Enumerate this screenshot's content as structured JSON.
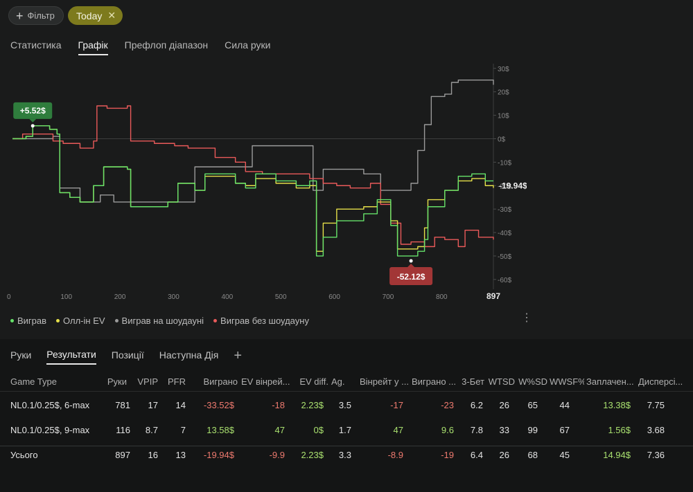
{
  "filter": {
    "add_label": "Фільтр",
    "chip_label": "Today"
  },
  "tabs": [
    "Статистика",
    "Графік",
    "Префлоп діапазон",
    "Сила руки"
  ],
  "chart_data": {
    "type": "line",
    "x_ticks": [
      "0",
      "100",
      "200",
      "300",
      "400",
      "500",
      "600",
      "700",
      "800",
      "897"
    ],
    "y_ticks": [
      "30$",
      "20$",
      "10$",
      "0$",
      "-10$",
      "-20$",
      "-30$",
      "-40$",
      "-50$",
      "-60$"
    ],
    "xlim": [
      0,
      897
    ],
    "ylim": [
      -63,
      32
    ],
    "colors": {
      "won": "#66e36a",
      "allin": "#e6e04a",
      "showdown": "#9b9b9b",
      "nonsd": "#ea5a5a"
    },
    "callouts": {
      "max_label": "+5.52$",
      "min_label": "-52.12$",
      "end_label": "-19.94$"
    },
    "series": [
      {
        "name": "Виграв",
        "color": "#66e36a",
        "points": [
          [
            0,
            0
          ],
          [
            20,
            1
          ],
          [
            30,
            5.5
          ],
          [
            55,
            4
          ],
          [
            66,
            2
          ],
          [
            70,
            -23
          ],
          [
            85,
            -25
          ],
          [
            100,
            -27
          ],
          [
            120,
            -20
          ],
          [
            135,
            -12
          ],
          [
            170,
            -13
          ],
          [
            175,
            -29
          ],
          [
            230,
            -27
          ],
          [
            245,
            -19
          ],
          [
            270,
            -22
          ],
          [
            285,
            -15
          ],
          [
            330,
            -19
          ],
          [
            345,
            -21
          ],
          [
            360,
            -15
          ],
          [
            390,
            -18
          ],
          [
            420,
            -20
          ],
          [
            440,
            -18
          ],
          [
            450,
            -50
          ],
          [
            460,
            -42
          ],
          [
            480,
            -35
          ],
          [
            520,
            -32
          ],
          [
            540,
            -26
          ],
          [
            560,
            -37
          ],
          [
            570,
            -50
          ],
          [
            600,
            -48
          ],
          [
            610,
            -43
          ],
          [
            615,
            -29
          ],
          [
            640,
            -22
          ],
          [
            660,
            -16
          ],
          [
            680,
            -15
          ],
          [
            700,
            -18
          ],
          [
            712,
            -18
          ]
        ]
      },
      {
        "name": "Олл-ін EV",
        "color": "#e6e04a",
        "points": [
          [
            0,
            0
          ],
          [
            20,
            1
          ],
          [
            30,
            5.5
          ],
          [
            55,
            4
          ],
          [
            66,
            2
          ],
          [
            70,
            -23
          ],
          [
            85,
            -25
          ],
          [
            100,
            -27
          ],
          [
            120,
            -20
          ],
          [
            135,
            -12
          ],
          [
            170,
            -13
          ],
          [
            175,
            -29
          ],
          [
            230,
            -27
          ],
          [
            245,
            -19
          ],
          [
            270,
            -22
          ],
          [
            285,
            -16
          ],
          [
            330,
            -19
          ],
          [
            345,
            -20
          ],
          [
            360,
            -17
          ],
          [
            390,
            -19
          ],
          [
            420,
            -21
          ],
          [
            440,
            -20
          ],
          [
            450,
            -48
          ],
          [
            460,
            -36
          ],
          [
            480,
            -30
          ],
          [
            520,
            -29
          ],
          [
            540,
            -27
          ],
          [
            560,
            -35
          ],
          [
            570,
            -47
          ],
          [
            600,
            -46
          ],
          [
            610,
            -38
          ],
          [
            615,
            -26
          ],
          [
            640,
            -22
          ],
          [
            660,
            -18
          ],
          [
            680,
            -17
          ],
          [
            700,
            -20
          ],
          [
            712,
            -21
          ]
        ]
      },
      {
        "name": "Виграв на шоудауні",
        "color": "#9b9b9b",
        "points": [
          [
            0,
            0
          ],
          [
            60,
            1
          ],
          [
            70,
            -21
          ],
          [
            90,
            -21
          ],
          [
            100,
            -27
          ],
          [
            130,
            -24
          ],
          [
            150,
            -27
          ],
          [
            240,
            -27
          ],
          [
            270,
            -12
          ],
          [
            350,
            -12
          ],
          [
            355,
            -3
          ],
          [
            440,
            -3
          ],
          [
            445,
            -22
          ],
          [
            460,
            -13
          ],
          [
            520,
            -15
          ],
          [
            545,
            -22
          ],
          [
            575,
            -22
          ],
          [
            590,
            -19
          ],
          [
            600,
            -5
          ],
          [
            610,
            6
          ],
          [
            620,
            18
          ],
          [
            640,
            19
          ],
          [
            650,
            24
          ],
          [
            660,
            25
          ],
          [
            712,
            23
          ]
        ]
      },
      {
        "name": "Виграв без шоудауну",
        "color": "#ea5a5a",
        "points": [
          [
            0,
            0
          ],
          [
            15,
            2
          ],
          [
            40,
            2
          ],
          [
            60,
            -1
          ],
          [
            75,
            -2
          ],
          [
            100,
            -4
          ],
          [
            120,
            -1
          ],
          [
            125,
            14
          ],
          [
            140,
            13
          ],
          [
            170,
            14
          ],
          [
            175,
            -1
          ],
          [
            210,
            -2
          ],
          [
            240,
            -3
          ],
          [
            260,
            -4
          ],
          [
            300,
            -8
          ],
          [
            330,
            -10
          ],
          [
            345,
            -14
          ],
          [
            370,
            -15
          ],
          [
            400,
            -15
          ],
          [
            440,
            -17
          ],
          [
            460,
            -19
          ],
          [
            480,
            -20
          ],
          [
            500,
            -21
          ],
          [
            530,
            -19
          ],
          [
            545,
            -28
          ],
          [
            560,
            -36
          ],
          [
            575,
            -45
          ],
          [
            590,
            -44
          ],
          [
            610,
            -46
          ],
          [
            625,
            -42
          ],
          [
            640,
            -43
          ],
          [
            660,
            -46
          ],
          [
            670,
            -39
          ],
          [
            690,
            -42
          ],
          [
            712,
            -43
          ]
        ]
      }
    ]
  },
  "legend": [
    "Виграв",
    "Олл-ін EV",
    "Виграв на шоудауні",
    "Виграв без шоудауну"
  ],
  "bottom_tabs": [
    "Руки",
    "Результати",
    "Позиції",
    "Наступна Дія",
    "+"
  ],
  "table": {
    "headers": [
      "Game Type",
      "Руки",
      "VPIP",
      "PFR",
      "Виграно",
      "EV вінрей...",
      "EV diff.",
      "Ag.",
      "Вінрейт у ...",
      "Виграно ...",
      "3-Бет",
      "WTSD",
      "W%SD",
      "WWSF%",
      "Заплачен...",
      "Дисперсі..."
    ],
    "rows": [
      [
        "NL0.1/0.25$, 6-max",
        "781",
        "17",
        "14",
        "-33.52$",
        "-18",
        "2.23$",
        "3.5",
        "-17",
        "-23",
        "6.2",
        "26",
        "65",
        "44",
        "13.38$",
        "7.75"
      ],
      [
        "NL0.1/0.25$, 9-max",
        "116",
        "8.7",
        "7",
        "13.58$",
        "47",
        "0$",
        "1.7",
        "47",
        "9.6",
        "7.8",
        "33",
        "99",
        "67",
        "1.56$",
        "3.68"
      ]
    ],
    "total": [
      "Усього",
      "897",
      "16",
      "13",
      "-19.94$",
      "-9.9",
      "2.23$",
      "3.3",
      "-8.9",
      "-19",
      "6.4",
      "26",
      "68",
      "45",
      "14.94$",
      "7.36"
    ]
  }
}
